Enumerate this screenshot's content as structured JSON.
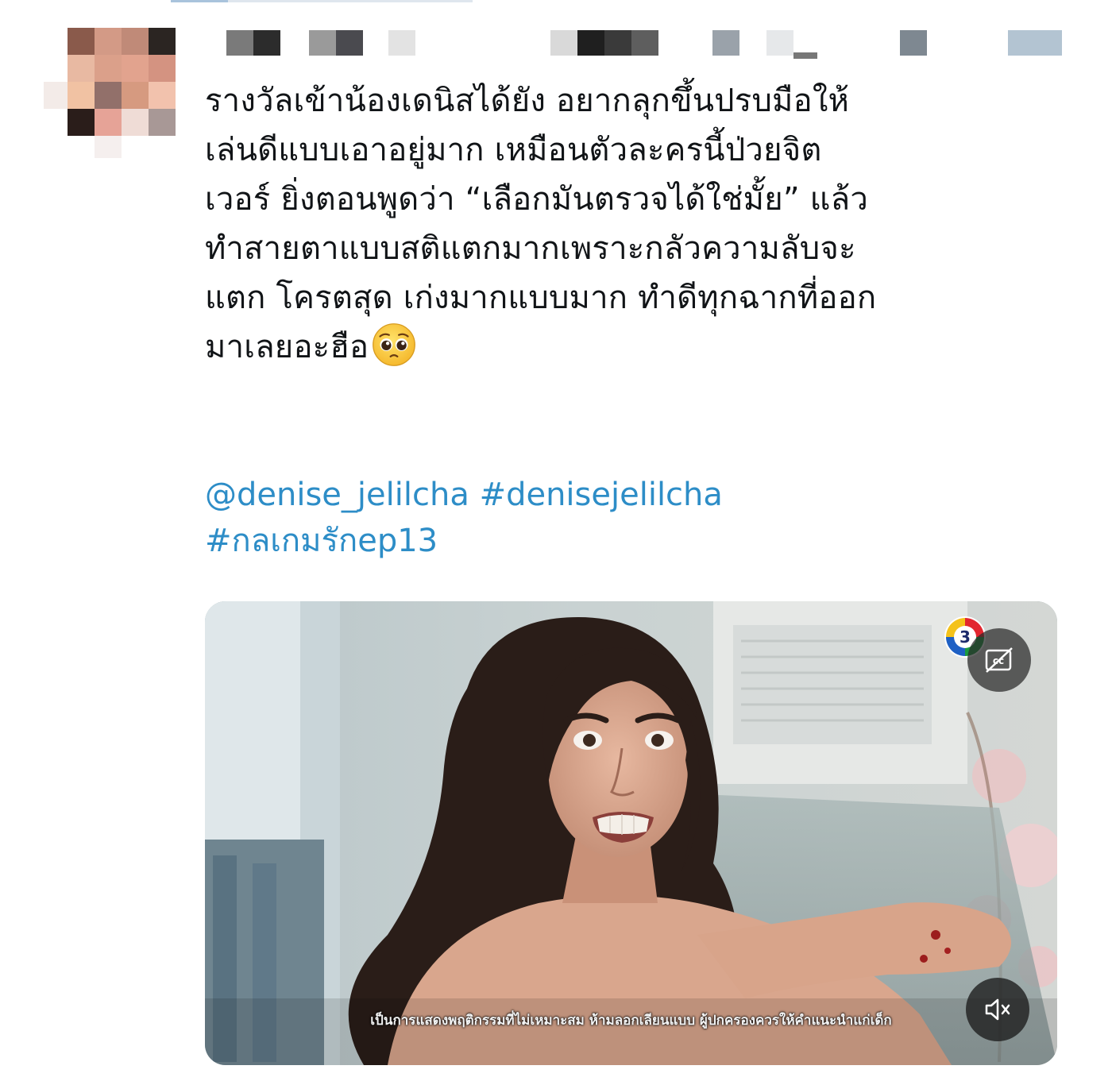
{
  "tweet": {
    "text_lines": [
      "รางวัลเข้าน้องเดนิสได้ยัง อยากลุกขึ้นปรบมือให้",
      "เล่นดีแบบเอาอยู่มาก เหมือนตัวละครนี้ป่วยจิต",
      "เวอร์ ยิ่งตอนพูดว่า “เลือกมันตรวจได้ใช่มั้ย” แล้ว",
      "ทำสายตาแบบสติแตกมากเพราะกลัวความลับจะ",
      "แตก โครตสุด เก่งมากแบบมาก ทำดีทุกฉากที่ออก",
      "มาเลยอะฮือ"
    ],
    "emoji": "pleading-face",
    "mention": "@denise_jelilcha",
    "hashtags": [
      "#denisejelilcha",
      "#กลเกมรักep13"
    ]
  },
  "media": {
    "type": "video",
    "subtitle": "เป็นการแสดงพฤติกรรมที่ไม่เหมาะสม ห้ามลอกเลียนแบบ ผู้ปกครองควรให้คำแนะนำแก่เด็ก",
    "channel_logo": "channel-3-logo",
    "cc_icon": "captions-off-icon",
    "mute_icon": "volume-muted-icon"
  },
  "colors": {
    "text": "#111417",
    "link": "#2d8dc7",
    "background": "#ffffff"
  }
}
